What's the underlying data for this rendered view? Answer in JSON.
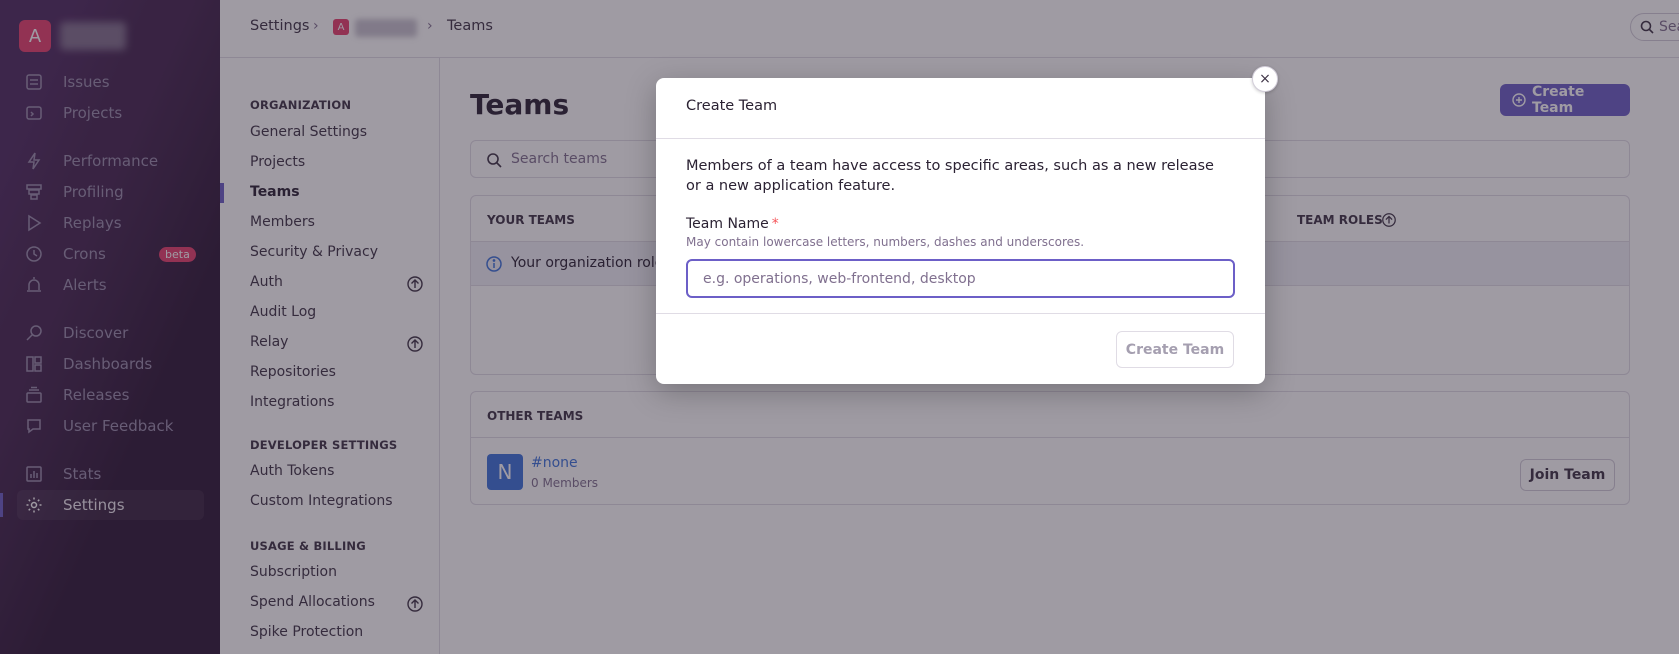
{
  "org": {
    "avatar_letter": "A"
  },
  "sidebar": {
    "items": [
      {
        "label": "Issues",
        "icon": "issues-icon"
      },
      {
        "label": "Projects",
        "icon": "projects-icon"
      },
      {
        "label": "Performance",
        "icon": "performance-icon"
      },
      {
        "label": "Profiling",
        "icon": "profiling-icon"
      },
      {
        "label": "Replays",
        "icon": "replays-icon"
      },
      {
        "label": "Crons",
        "icon": "crons-icon",
        "badge": "beta"
      },
      {
        "label": "Alerts",
        "icon": "alerts-icon"
      },
      {
        "label": "Discover",
        "icon": "discover-icon"
      },
      {
        "label": "Dashboards",
        "icon": "dashboards-icon"
      },
      {
        "label": "Releases",
        "icon": "releases-icon"
      },
      {
        "label": "User Feedback",
        "icon": "user-feedback-icon"
      },
      {
        "label": "Stats",
        "icon": "stats-icon"
      },
      {
        "label": "Settings",
        "icon": "settings-icon",
        "active": true
      }
    ]
  },
  "breadcrumb": {
    "settings": "Settings",
    "org_avatar_letter": "A",
    "current": "Teams"
  },
  "top_search": {
    "placeholder": "Sea"
  },
  "settings_nav": {
    "organization_heading": "ORGANIZATION",
    "organization_items": [
      "General Settings",
      "Projects",
      "Teams",
      "Members",
      "Security & Privacy",
      "Auth",
      "Audit Log",
      "Relay",
      "Repositories",
      "Integrations"
    ],
    "developer_heading": "DEVELOPER SETTINGS",
    "developer_items": [
      "Auth Tokens",
      "Custom Integrations"
    ],
    "billing_heading": "USAGE & BILLING",
    "billing_items": [
      "Subscription",
      "Spend Allocations",
      "Spike Protection"
    ]
  },
  "main": {
    "title": "Teams",
    "create_button": "Create Team",
    "search_placeholder": "Search teams",
    "your_teams": {
      "heading": "YOUR TEAMS",
      "roles_heading": "TEAM ROLES",
      "info_text": "Your organization role"
    },
    "other_teams": {
      "heading": "OTHER TEAMS",
      "teams": [
        {
          "avatar_letter": "N",
          "name": "#none",
          "members": "0 Members",
          "join_label": "Join Team"
        }
      ]
    }
  },
  "modal": {
    "title": "Create Team",
    "description": "Members of a team have access to specific areas, such as a new release or a new application feature.",
    "field_label": "Team Name",
    "field_required": "*",
    "field_help": "May contain lowercase letters, numbers, dashes and underscores.",
    "field_placeholder": "e.g. operations, web-frontend, desktop",
    "field_value": "",
    "submit_label": "Create Team",
    "close_symbol": "×"
  },
  "colors": {
    "accent": "#6c5fc7",
    "link": "#3d74db",
    "badge": "#e8406d"
  }
}
